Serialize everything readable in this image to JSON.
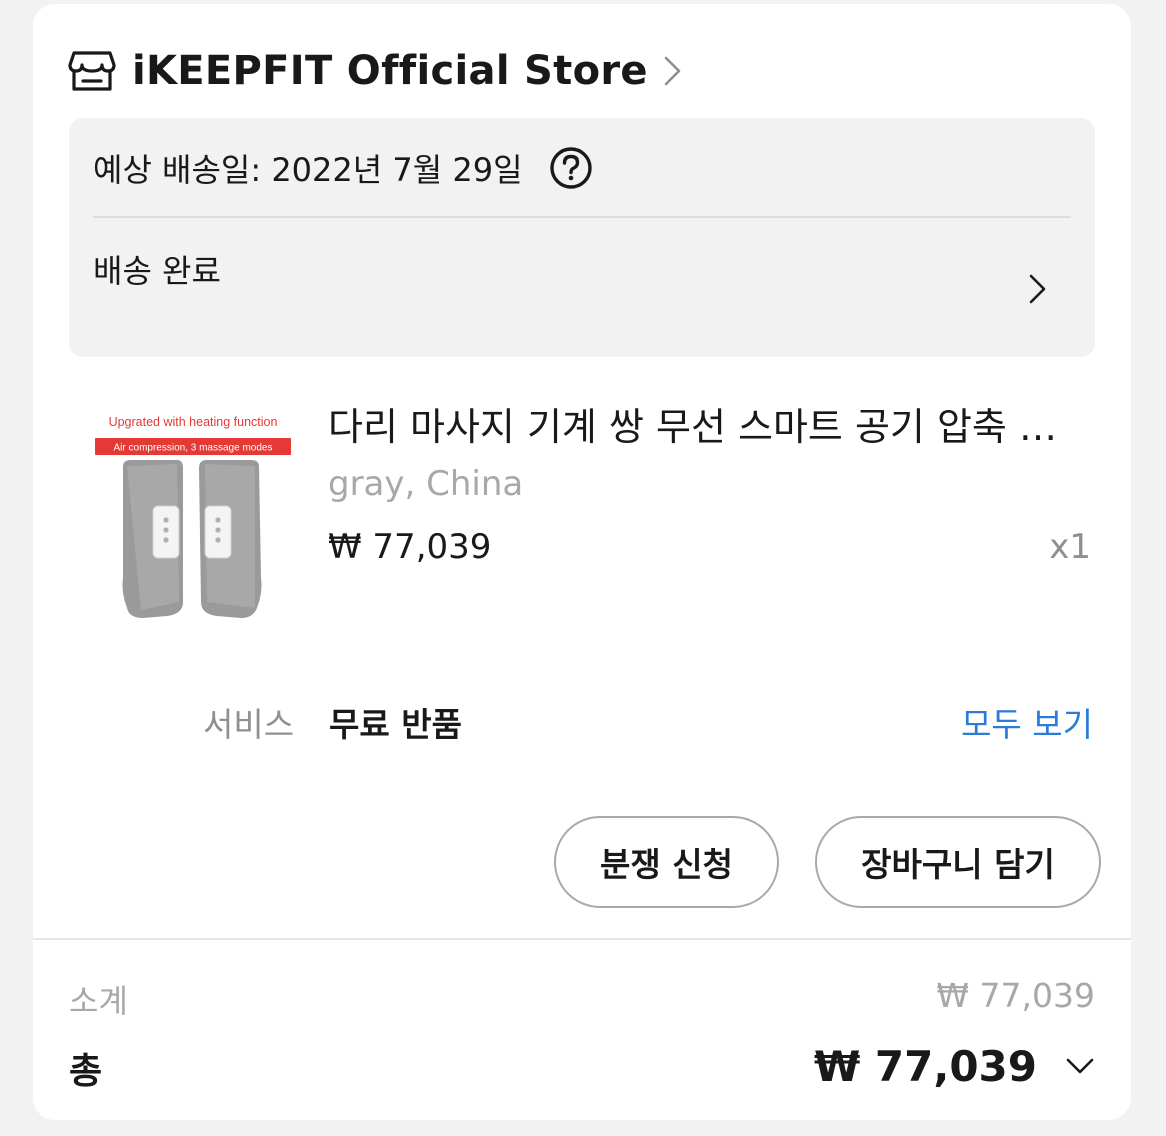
{
  "store": {
    "name": "iKEEPFIT Official Store",
    "icon": "store-icon",
    "chevron_icon": "chevron-right-icon"
  },
  "delivery": {
    "estimated_date": "예상 배송일: 2022년 7월 29일",
    "help_icon": "question-circle-icon",
    "status": "배송 완료"
  },
  "product": {
    "image": {
      "line1": "Upgrated with heating function",
      "line2": "Air compression, 3 massage modes"
    },
    "title": "다리 마사지 기계 쌍 무선 스마트 공기 압축 다리 마사지기",
    "variant": "gray, China",
    "price": "₩ 77,039",
    "quantity": "x1"
  },
  "service": {
    "label": "서비스",
    "value": "무료 반품",
    "link": "모두 보기"
  },
  "actions": {
    "dispute": "분쟁 신청",
    "add_to_cart": "장바구니 담기"
  },
  "summary": {
    "subtotal_label": "소계",
    "subtotal_value": "₩ 77,039",
    "total_label": "총",
    "total_value": "₩ 77,039"
  },
  "colors": {
    "link": "#2b7bd8",
    "accent_red": "#e53935",
    "muted_text": "#a8a8a8"
  }
}
